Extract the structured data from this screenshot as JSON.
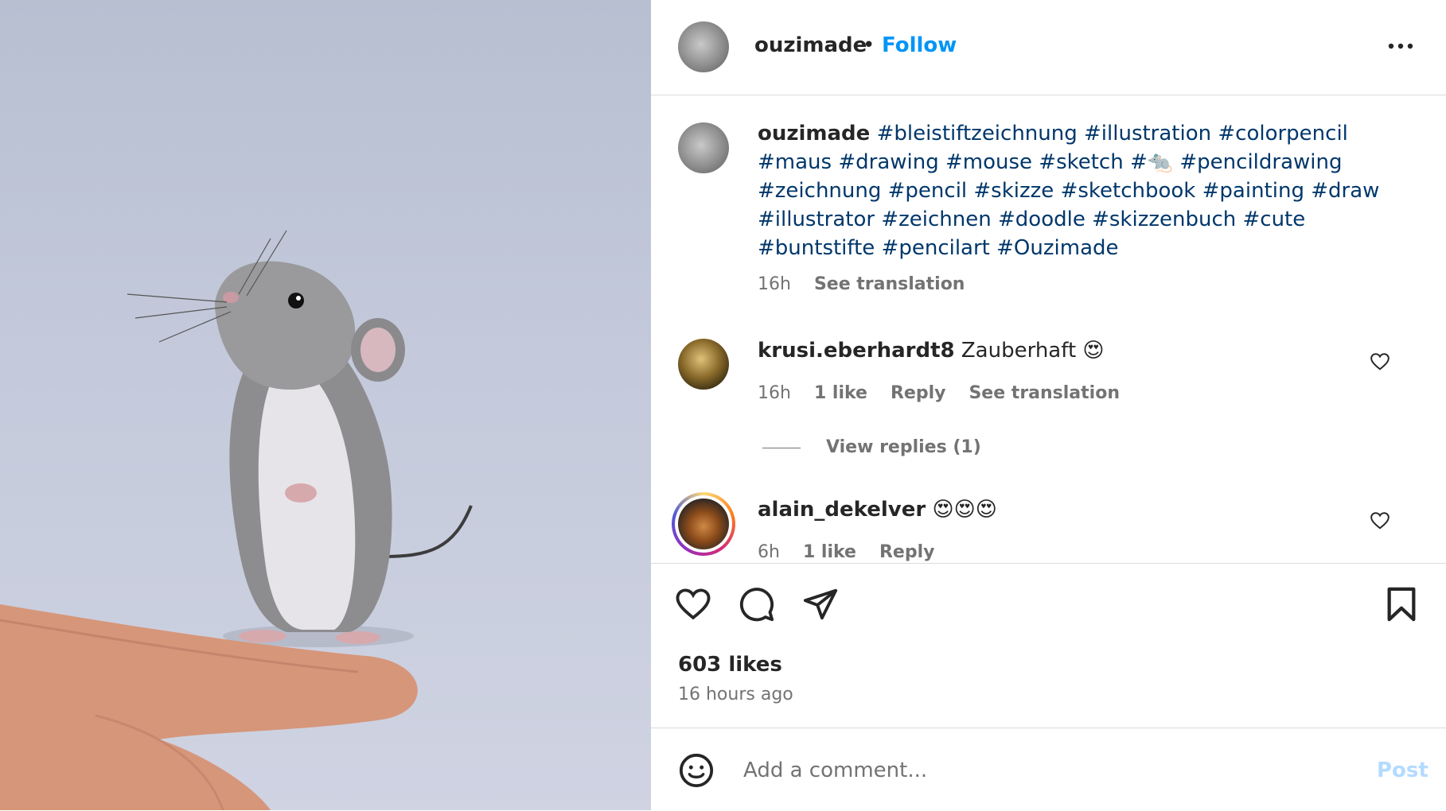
{
  "post": {
    "username": "ouzimade",
    "separator": "•",
    "follow_label": "Follow",
    "more_icon": "more-horizontal-icon",
    "image_alt": "pencil drawing of a mouse on paper next to a finger"
  },
  "caption": {
    "username": "ouzimade",
    "hashtags": "#bleistiftzeichnung #illustration #colorpencil #maus #drawing #mouse #sketch #🐀 #pencildrawing #zeichnung #pencil #skizze #sketchbook #painting #draw #illustrator #zeichnen #doodle #skizzenbuch #cute #buntstifte #pencilart #Ouzimade",
    "time": "16h",
    "see_translation": "See translation"
  },
  "comments": [
    {
      "username": "krusi.eberhardt8",
      "text": "Zauberhaft 😍",
      "time": "16h",
      "likes": "1 like",
      "reply": "Reply",
      "see_translation": "See translation",
      "view_replies": "View replies (1)"
    },
    {
      "username": "alain_dekelver",
      "text": "😍😍😍",
      "time": "6h",
      "likes": "1 like",
      "reply": "Reply"
    }
  ],
  "actions": {
    "likes": "603 likes",
    "posted": "16 hours ago"
  },
  "composer": {
    "placeholder": "Add a comment...",
    "post_label": "Post"
  },
  "colors": {
    "accent": "#0095f6",
    "hashtag": "#00376b",
    "muted": "#737373",
    "post_disabled": "#b3dbff"
  }
}
